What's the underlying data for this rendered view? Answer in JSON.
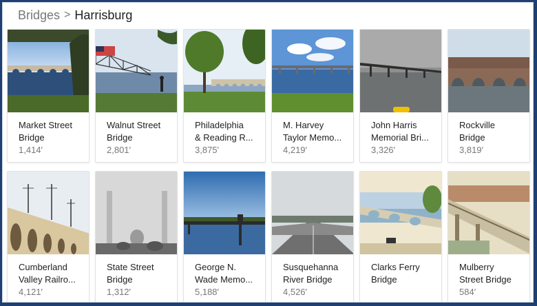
{
  "breadcrumb": {
    "parent": "Bridges",
    "separator": ">",
    "current": "Harrisburg"
  },
  "bridges": [
    {
      "name_line1": "Market Street",
      "name_line2": "Bridge",
      "length": "1,414′"
    },
    {
      "name_line1": "Walnut Street",
      "name_line2": "Bridge",
      "length": "2,801′"
    },
    {
      "name_line1": "Philadelphia",
      "name_line2": "& Reading R...",
      "length": "3,875′"
    },
    {
      "name_line1": "M. Harvey",
      "name_line2": "Taylor Memo...",
      "length": "4,219′"
    },
    {
      "name_line1": "John Harris",
      "name_line2": "Memorial Bri...",
      "length": "3,326′"
    },
    {
      "name_line1": "Rockville",
      "name_line2": "Bridge",
      "length": "3,819′"
    },
    {
      "name_line1": "Cumberland",
      "name_line2": "Valley Railro...",
      "length": "4,121′"
    },
    {
      "name_line1": "State Street",
      "name_line2": "Bridge",
      "length": "1,312′"
    },
    {
      "name_line1": "George N.",
      "name_line2": "Wade Memo...",
      "length": "5,188′"
    },
    {
      "name_line1": "Susquehanna",
      "name_line2": "River Bridge",
      "length": "4,526′"
    },
    {
      "name_line1": "Clarks Ferry",
      "name_line2": "Bridge",
      "length": ""
    },
    {
      "name_line1": "Mulberry",
      "name_line2": "Street Bridge",
      "length": "584′"
    }
  ],
  "colors": {
    "page_border": "#1f3f73",
    "text_primary": "#222222",
    "text_secondary": "#777777"
  }
}
